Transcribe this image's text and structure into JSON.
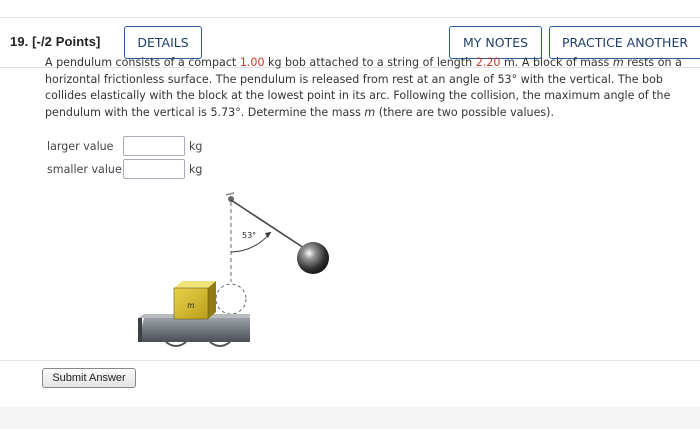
{
  "question": {
    "number": "19.",
    "points": "[-/2 Points]",
    "details_label": "DETAILS",
    "my_notes_label": "MY NOTES",
    "practice_label": "PRACTICE ANOTHER",
    "text": {
      "p1": "A pendulum consists of a compact ",
      "mass_val": "1.00",
      "p2": " kg bob attached to a string of length ",
      "length_val": "2.20",
      "p3": " m. A block of mass ",
      "m_sym": "m",
      "p4": " rests on a horizontal frictionless surface. The pendulum is released from rest at an angle of 53° with the vertical. The bob collides elastically with the block at the lowest point in its arc. Following the collision, the maximum angle of the pendulum with the vertical is 5.73°. Determine the mass ",
      "m_sym2": "m",
      "p5": " (there are two possible values)."
    },
    "answers": [
      {
        "label": "larger value",
        "value": "",
        "unit": "kg"
      },
      {
        "label": "smaller value",
        "value": "",
        "unit": "kg"
      }
    ],
    "figure": {
      "angle_label": "53°",
      "block_label": "m"
    },
    "submit_label": "Submit Answer"
  },
  "colors": {
    "accent": "#2a5d9f",
    "given_value": "#c0392b"
  }
}
